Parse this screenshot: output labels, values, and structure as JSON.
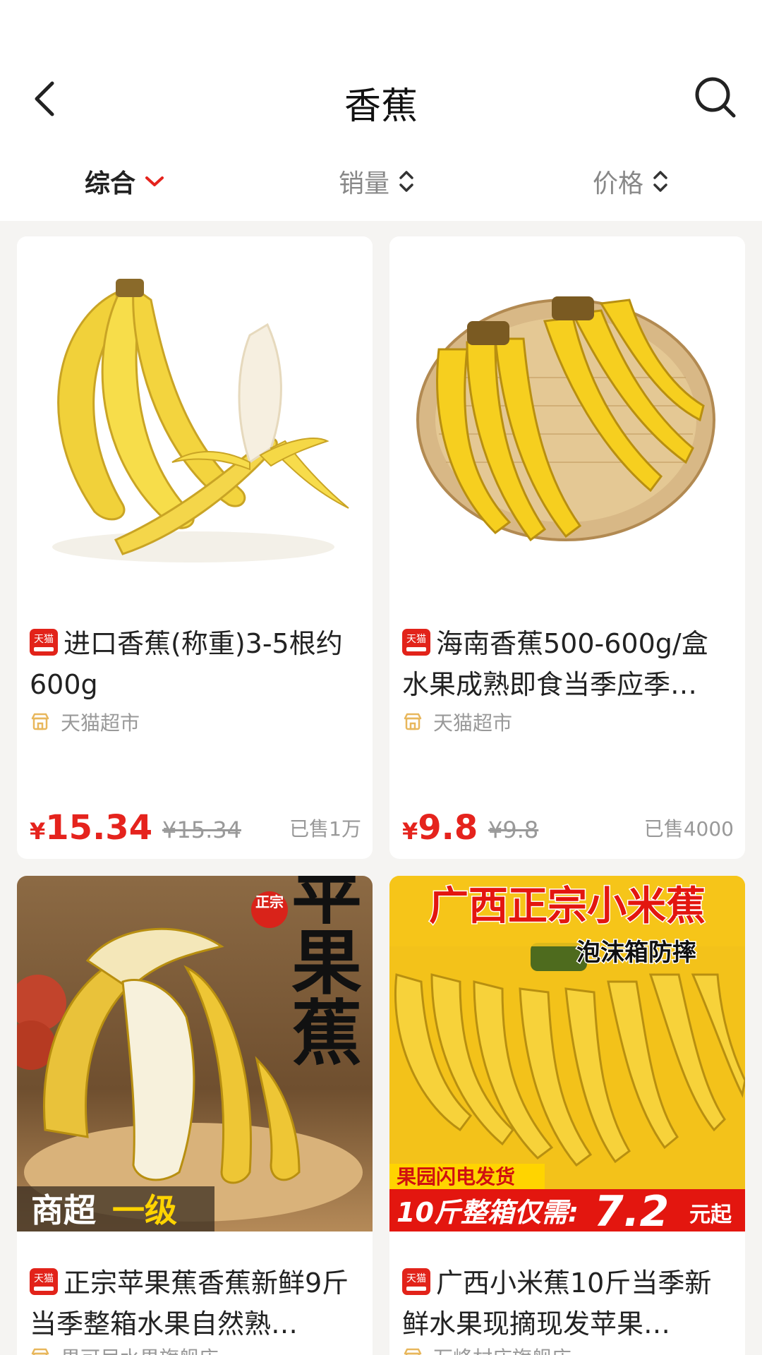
{
  "header": {
    "title": "香蕉"
  },
  "sort": {
    "items": [
      {
        "label": "综合",
        "active": true
      },
      {
        "label": "销量",
        "active": false
      },
      {
        "label": "价格",
        "active": false
      }
    ]
  },
  "colors": {
    "price": "#e5231d",
    "accent": "#e2231a"
  },
  "products": [
    {
      "badge": "天猫",
      "title": "进口香蕉(称重)3-5根约600g",
      "shop": "天猫超市",
      "currency": "¥",
      "price": "15.34",
      "original_price": "¥15.34",
      "sold": "已售1万"
    },
    {
      "badge": "天猫",
      "title": "海南香蕉500-600g/盒水果成熟即食当季应季…",
      "shop": "天猫超市",
      "currency": "¥",
      "price": "9.8",
      "original_price": "¥9.8",
      "sold": "已售4000"
    },
    {
      "badge": "天猫",
      "title": "正宗苹果蕉香蕉新鲜9斤当季整箱水果自然熟…",
      "shop": "果可尼水果旗舰店",
      "img_text": {
        "side": "苹果蕉",
        "seal": "正宗",
        "bottom_a": "商超",
        "bottom_b": "一级"
      }
    },
    {
      "badge": "天猫",
      "title": "广西小米蕉10斤当季新鲜水果现摘现发苹果…",
      "shop": "万峰村庄旗舰店",
      "img_text": {
        "top": "广西正宗小米蕉",
        "sub": "泡沫箱防摔",
        "strip": "果园闪电发货",
        "bottom_a": "10斤整箱仅需:",
        "bottom_num": "7.2",
        "bottom_b": "元起"
      }
    }
  ]
}
